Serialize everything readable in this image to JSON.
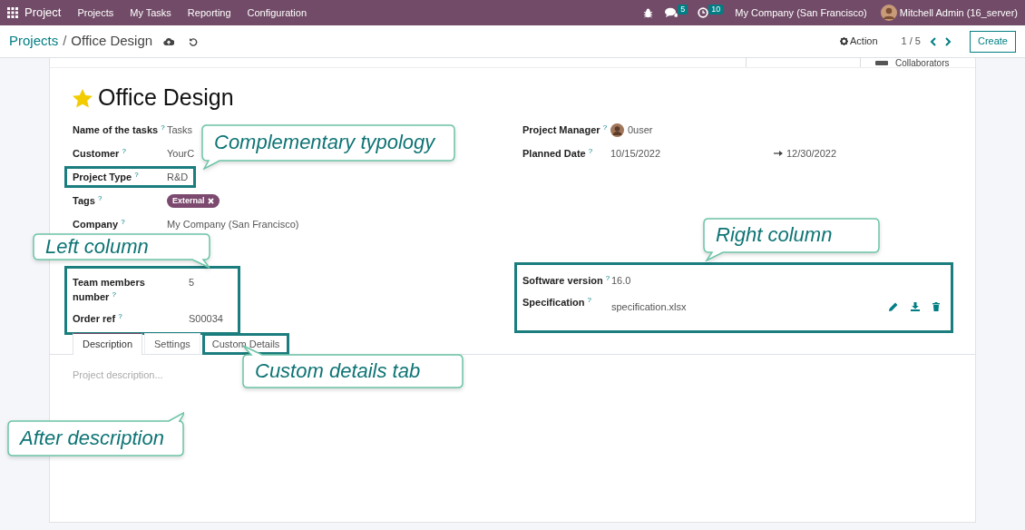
{
  "navbar": {
    "app_name": "Project",
    "menu": [
      "Projects",
      "My Tasks",
      "Reporting",
      "Configuration"
    ],
    "chat_count": "5",
    "activity_count": "10",
    "company": "My Company (San Francisco)",
    "user": "Mitchell Admin (16_server)"
  },
  "control_panel": {
    "breadcrumb": [
      {
        "label": "Projects"
      },
      {
        "label": "Office Design"
      }
    ],
    "separator": "/",
    "action": "Action",
    "pager": "1 / 5",
    "create": "Create"
  },
  "stat_buttons": [
    {
      "label": "Collaborators"
    }
  ],
  "form": {
    "title": "Office Design",
    "favorite": true,
    "left_fields": [
      {
        "kind": "text",
        "label": "Name of the tasks",
        "help": "?",
        "value": "Tasks",
        "highlighted": false
      },
      {
        "kind": "text",
        "label": "Customer",
        "help": "?",
        "value": "YourC",
        "highlighted": false
      },
      {
        "kind": "text",
        "label": "Project Type",
        "help": "?",
        "value": "R&D",
        "highlighted": true
      },
      {
        "kind": "tags",
        "label": "Tags",
        "help": "?",
        "tags": [
          "External"
        ],
        "highlighted": false
      },
      {
        "kind": "text",
        "label": "Company",
        "help": "?",
        "value": "My Company (San Francisco)",
        "highlighted": false
      }
    ],
    "right_fields": [
      {
        "kind": "user",
        "label": "Project Manager",
        "help": "?",
        "value": "0user"
      },
      {
        "kind": "daterange",
        "label": "Planned Date",
        "help": "?",
        "value": "10/15/2022",
        "end": "12/30/2022"
      }
    ],
    "custom_left": {
      "highlighted": true,
      "fields": [
        {
          "kind": "text",
          "label": "Team members number",
          "help": "?",
          "value": "5"
        },
        {
          "kind": "text",
          "label": "Order ref",
          "help": "?",
          "value": "S00034"
        }
      ]
    },
    "custom_right": {
      "highlighted": true,
      "fields": [
        {
          "kind": "text",
          "label": "Software version",
          "help": "?",
          "value": "16.0"
        },
        {
          "kind": "file",
          "label": "Specification",
          "help": "?",
          "value": "specification.xlsx"
        }
      ]
    },
    "tabs": [
      {
        "label": "Description",
        "selected": true,
        "highlighted": false
      },
      {
        "label": "Settings",
        "selected": false,
        "highlighted": false
      },
      {
        "label": "Custom Details",
        "selected": false,
        "highlighted": true
      }
    ],
    "description_placeholder": "Project description..."
  },
  "callouts": [
    {
      "text": "Complementary typology"
    },
    {
      "text": "Left column"
    },
    {
      "text": "Right column"
    },
    {
      "text": "Custom details tab"
    },
    {
      "text": "After description"
    }
  ]
}
